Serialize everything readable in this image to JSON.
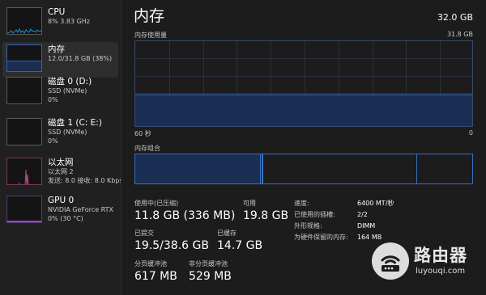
{
  "colors": {
    "memory_accent": "#2f63b8",
    "memory_fill": "#1a2d52",
    "cpu_accent": "#1e90c8",
    "ethernet_accent": "#b0517d",
    "gpu_accent": "#8a4fb8"
  },
  "sidebar": {
    "items": [
      {
        "title": "CPU",
        "line1": "8% 3.83 GHz",
        "line2": ""
      },
      {
        "title": "内存",
        "line1": "12.0/31.8 GB (38%)",
        "line2": ""
      },
      {
        "title": "磁盘 0 (D:)",
        "line1": "SSD (NVMe)",
        "line2": "0%"
      },
      {
        "title": "磁盘 1 (C: E:)",
        "line1": "SSD (NVMe)",
        "line2": "0%"
      },
      {
        "title": "以太网",
        "line1": "以太网 2",
        "line2": "发送: 8.0 接收: 8.0 Kbps"
      },
      {
        "title": "GPU 0",
        "line1": "NVIDIA GeForce RTX",
        "line2": "0% (30 °C)"
      }
    ]
  },
  "main": {
    "title": "内存",
    "capacity": "32.0 GB",
    "usage_label": "内存使用量",
    "usage_max": "31.8 GB",
    "usage_fraction": 0.38,
    "axis_left": "60 秒",
    "axis_right": "0",
    "composition_label": "内存组合"
  },
  "stats": {
    "in_use_label": "使用中(已压缩)",
    "in_use_value": "11.8 GB (336 MB)",
    "available_label": "可用",
    "available_value": "19.8 GB",
    "committed_label": "已提交",
    "committed_value": "19.5/38.6 GB",
    "cached_label": "已缓存",
    "cached_value": "14.7 GB",
    "paged_label": "分页缓冲池",
    "paged_value": "617 MB",
    "nonpaged_label": "非分页缓冲池",
    "nonpaged_value": "529 MB"
  },
  "details": [
    {
      "key": "速度:",
      "value": "6400 MT/秒"
    },
    {
      "key": "已使用的插槽:",
      "value": "2/2"
    },
    {
      "key": "外形规格:",
      "value": "DIMM"
    },
    {
      "key": "为硬件保留的内存:",
      "value": "164 MB"
    }
  ],
  "watermark": {
    "text": "路由器",
    "url": "luyouqi.com"
  }
}
